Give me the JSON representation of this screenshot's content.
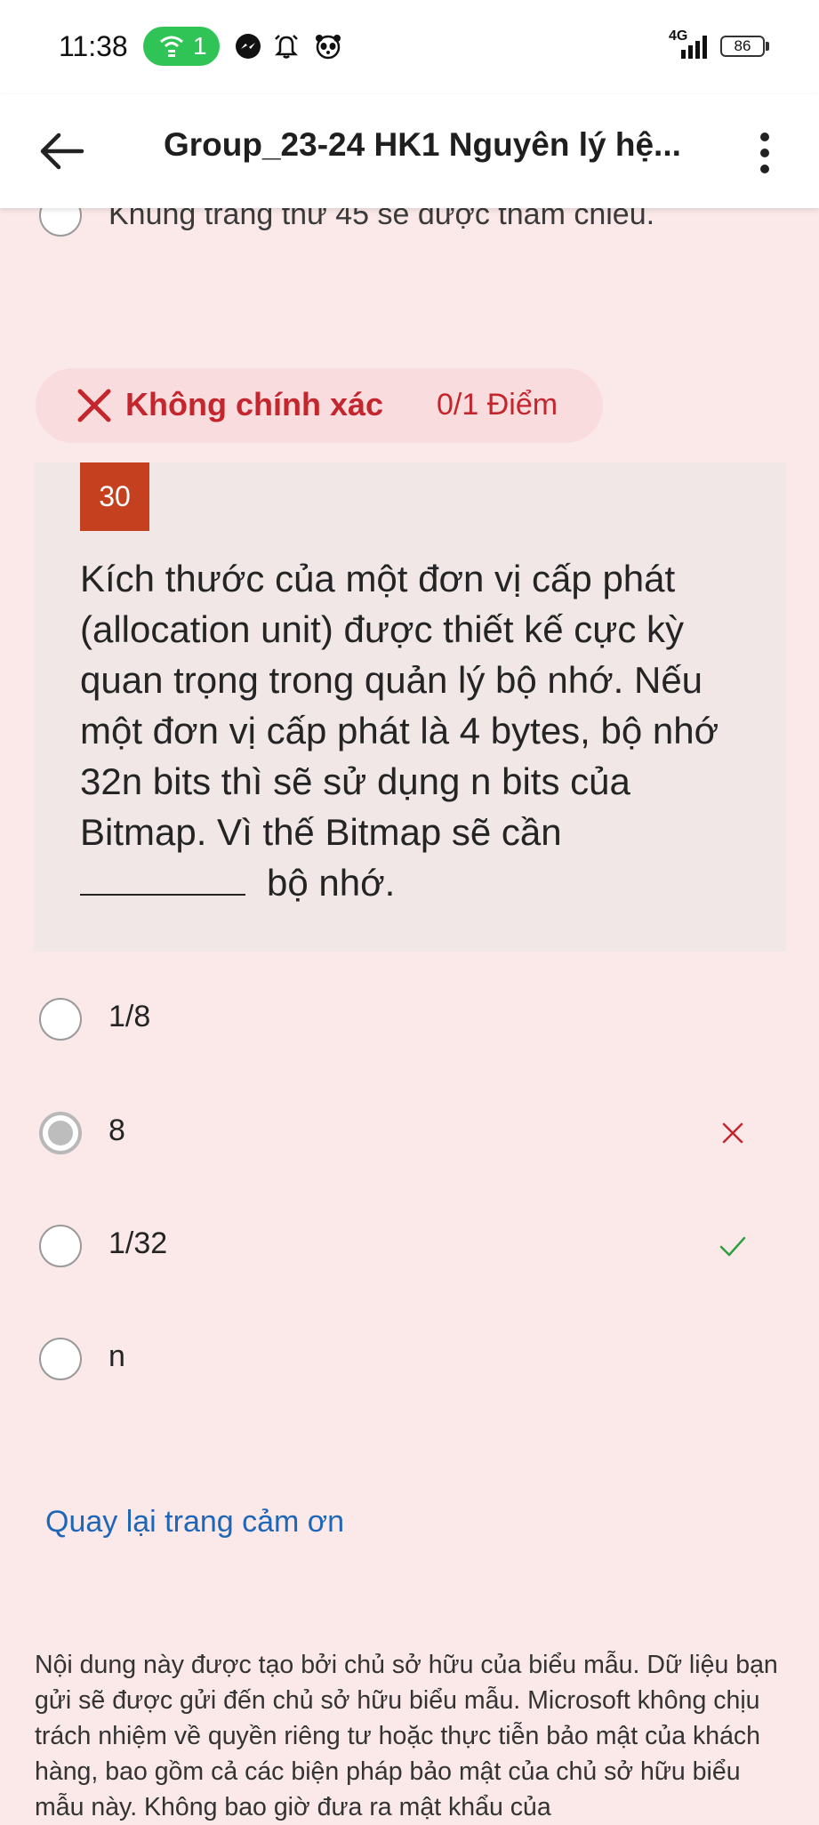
{
  "status_bar": {
    "time": "11:38",
    "hotspot_count": "1",
    "network": "4G",
    "battery": "86",
    "icons": [
      "wifi-hotspot-icon",
      "messenger-icon",
      "alarm-bell-icon",
      "panda-icon",
      "signal-icon",
      "battery-icon"
    ]
  },
  "header": {
    "back_icon": "arrow-left-icon",
    "title": "Group_23-24 HK1 Nguyên lý hệ...",
    "more_icon": "more-vertical-icon"
  },
  "previous_question": {
    "clipped_option_text": "Khung trang thứ 45 sẽ được tham chiếu."
  },
  "result": {
    "status": "Không chính xác",
    "score": "0/1 Điểm",
    "color": "#c4262e"
  },
  "question": {
    "number": "30",
    "text": "Kích thước của một đơn vị cấp phát (allocation unit) được thiết kế cực kỳ quan trọng trong quản lý bộ nhớ. Nếu một đơn vị cấp phát là 4 bytes, bộ nhớ 32n bits thì sẽ sử dụng n bits của Bitmap. Vì thế Bitmap sẽ cần",
    "text_after_blank": "bộ nhớ."
  },
  "options": [
    {
      "label": "1/8",
      "selected": false,
      "mark": ""
    },
    {
      "label": "8",
      "selected": true,
      "mark": "incorrect"
    },
    {
      "label": "1/32",
      "selected": false,
      "mark": "correct"
    },
    {
      "label": "n",
      "selected": false,
      "mark": ""
    }
  ],
  "link": {
    "label": "Quay lại trang cảm ơn",
    "color": "#1e66b8"
  },
  "disclaimer": "Nội dung này được tạo bởi chủ sở hữu của biểu mẫu. Dữ liệu bạn gửi sẽ được gửi đến chủ sở hữu biểu mẫu. Microsoft không chịu trách nhiệm về quyền riêng tư hoặc thực tiễn bảo mật của khách hàng, bao gồm cả các biện pháp bảo mật của chủ sở hữu biểu mẫu này. Không bao giờ đưa ra mật khẩu của",
  "colors": {
    "background": "#fbe9e9",
    "question_badge": "#c4401e",
    "correct": "#2e9e3e",
    "incorrect": "#c4262e"
  }
}
